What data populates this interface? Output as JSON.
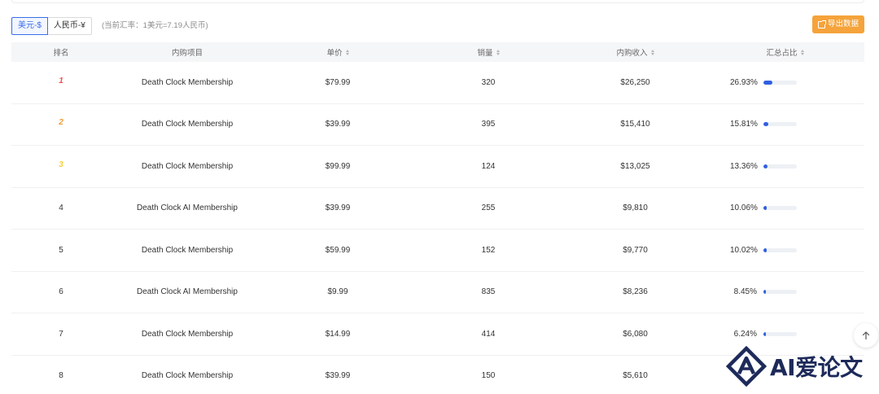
{
  "currency": {
    "usd_label": "美元-$",
    "cny_label": "人民币-¥",
    "rate_note": "(当前汇率：1美元=7.19人民币)"
  },
  "export_label": "导出数据",
  "columns": {
    "rank": "排名",
    "item": "内购项目",
    "price": "单价",
    "qty": "销量",
    "revenue": "内购收入",
    "share": "汇总占比"
  },
  "rows": [
    {
      "rank": "1",
      "item": "Death Clock Membership",
      "price": "$79.99",
      "qty": "320",
      "revenue": "$26,250",
      "share": "26.93%",
      "share_value": 26.93
    },
    {
      "rank": "2",
      "item": "Death Clock Membership",
      "price": "$39.99",
      "qty": "395",
      "revenue": "$15,410",
      "share": "15.81%",
      "share_value": 15.81
    },
    {
      "rank": "3",
      "item": "Death Clock Membership",
      "price": "$99.99",
      "qty": "124",
      "revenue": "$13,025",
      "share": "13.36%",
      "share_value": 13.36
    },
    {
      "rank": "4",
      "item": "Death Clock AI Membership",
      "price": "$39.99",
      "qty": "255",
      "revenue": "$9,810",
      "share": "10.06%",
      "share_value": 10.06
    },
    {
      "rank": "5",
      "item": "Death Clock Membership",
      "price": "$59.99",
      "qty": "152",
      "revenue": "$9,770",
      "share": "10.02%",
      "share_value": 10.02
    },
    {
      "rank": "6",
      "item": "Death Clock AI Membership",
      "price": "$9.99",
      "qty": "835",
      "revenue": "$8,236",
      "share": "8.45%",
      "share_value": 8.45
    },
    {
      "rank": "7",
      "item": "Death Clock Membership",
      "price": "$14.99",
      "qty": "414",
      "revenue": "$6,080",
      "share": "6.24%",
      "share_value": 6.24
    },
    {
      "rank": "8",
      "item": "Death Clock Membership",
      "price": "$39.99",
      "qty": "150",
      "revenue": "$5,610",
      "share": "",
      "share_value": null
    }
  ],
  "colors": {
    "accent": "#3a6ee8",
    "export_button": "#f5a33a",
    "bar_fill": "#2f5fe0",
    "medal_gold": "#f0504a",
    "medal_silver": "#f29a3a",
    "medal_bronze": "#f6cf3c"
  },
  "icons": {
    "export": "external-link-icon",
    "sort": "sort-caret-icon",
    "back_to_top": "arrow-up-icon"
  },
  "watermark": {
    "text": "AI爱论文"
  }
}
